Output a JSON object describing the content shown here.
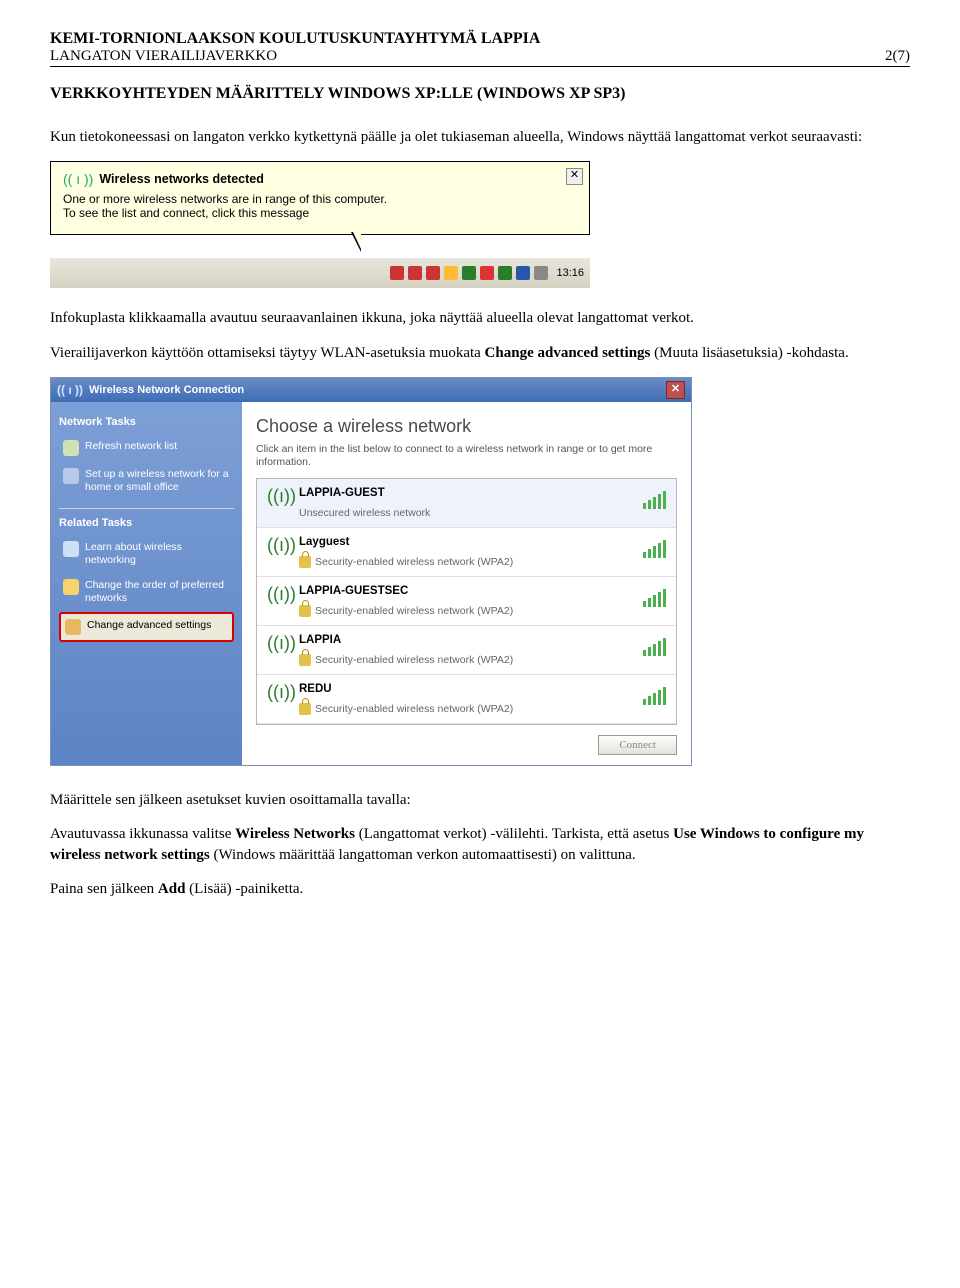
{
  "header": {
    "line1": "KEMI-TORNIONLAAKSON KOULUTUSKUNTAYHTYMÄ LAPPIA",
    "line2_left": "LANGATON VIERAILIJAVERKKO",
    "line2_right": "2(7)"
  },
  "section_title": "VERKKOYHTEYDEN MÄÄRITTELY WINDOWS XP:LLE (WINDOWS XP SP3)",
  "para1": "Kun tietokoneessasi on langaton verkko kytkettynä päälle ja olet tukiaseman alueella, Windows näyttää langattomat verkot seuraavasti:",
  "balloon": {
    "title": "Wireless networks detected",
    "line1": "One or more wireless networks are in range of this computer.",
    "line2": "To see the list and connect, click this message",
    "close": "✕"
  },
  "taskbar": {
    "clock": "13:16"
  },
  "para2": "Infokuplasta klikkaamalla avautuu seuraavanlainen ikkuna, joka näyttää alueella olevat langattomat verkot.",
  "para3_a": "Vierailijaverkon käyttöön ottamiseksi täytyy WLAN-asetuksia muokata ",
  "para3_b": "Change advanced settings",
  "para3_c": " (Muuta lisäasetuksia) -kohdasta.",
  "dialog": {
    "title": "Wireless Network Connection",
    "close": "✕",
    "side": {
      "group1": "Network Tasks",
      "refresh": "Refresh network list",
      "setup": "Set up a wireless network for a home or small office",
      "group2": "Related Tasks",
      "learn": "Learn about wireless networking",
      "order": "Change the order of preferred networks",
      "advanced": "Change advanced settings"
    },
    "main": {
      "choose_title": "Choose a wireless network",
      "choose_desc": "Click an item in the list below to connect to a wireless network in range or to get more information.",
      "networks": [
        {
          "ssid": "LAPPIA-GUEST",
          "sub": "Unsecured wireless network",
          "secured": false
        },
        {
          "ssid": "Layguest",
          "sub": "Security-enabled wireless network (WPA2)",
          "secured": true
        },
        {
          "ssid": "LAPPIA-GUESTSEC",
          "sub": "Security-enabled wireless network (WPA2)",
          "secured": true
        },
        {
          "ssid": "LAPPIA",
          "sub": "Security-enabled wireless network (WPA2)",
          "secured": true
        },
        {
          "ssid": "REDU",
          "sub": "Security-enabled wireless network (WPA2)",
          "secured": true
        }
      ],
      "connect": "Connect"
    }
  },
  "para4": "Määrittele sen jälkeen asetukset kuvien osoittamalla tavalla:",
  "para5_a": "Avautuvassa ikkunassa valitse ",
  "para5_b": "Wireless Networks",
  "para5_c": " (Langattomat verkot) -välilehti. Tarkista, että asetus ",
  "para5_d": "Use Windows to configure my wireless network settings",
  "para5_e": " (Windows määrittää langattoman verkon automaattisesti) on valittuna.",
  "para6_a": "Paina sen jälkeen ",
  "para6_b": "Add",
  "para6_c": " (Lisää) -painiketta."
}
